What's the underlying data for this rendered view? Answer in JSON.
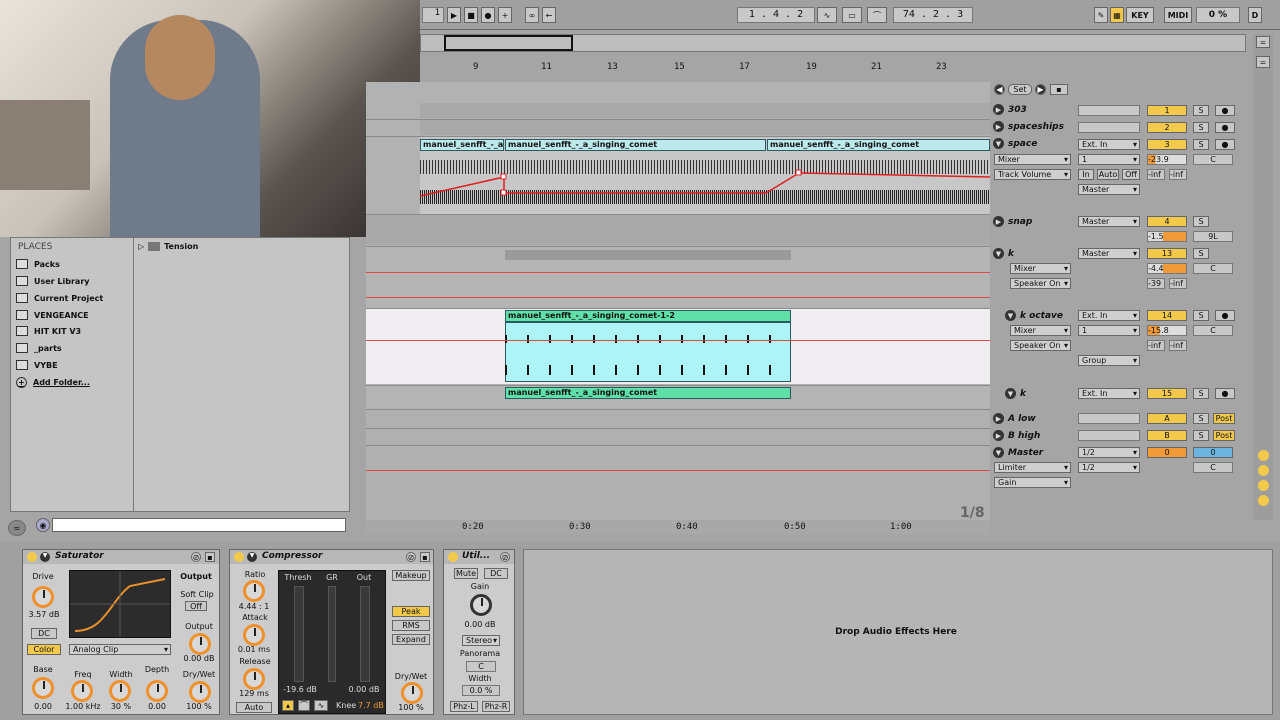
{
  "transport": {
    "bar_position": "1 . 4 . 2",
    "tempo_pos": "74 . 2 . 3",
    "loop_start": "1",
    "key_label": "KEY",
    "midi_label": "MIDI",
    "cpu": "0 %",
    "d_label": "D"
  },
  "ruler": {
    "bars": [
      "9",
      "11",
      "13",
      "15",
      "17",
      "19",
      "21",
      "23"
    ],
    "times": [
      "0:20",
      "0:30",
      "0:40",
      "0:50",
      "1:00"
    ]
  },
  "set_label": "Set",
  "clips": {
    "top1": "manuel_senfft_-_a_singing_comet",
    "top0": "manuel_senfft_-_a_singing_com",
    "top2": "manuel_senfft_-_a_singing_comet",
    "mid": "manuel_senfft_-_a_singing_comet-1-2",
    "bottom": "manuel_senfft_-_a_singing_comet"
  },
  "page_counter": "1/8",
  "tracks": [
    {
      "name": "303",
      "num": "1",
      "rec": "S"
    },
    {
      "name": "spaceships",
      "num": "2",
      "rec": "S"
    },
    {
      "name": "space",
      "num": "3",
      "input": "Ext. In",
      "channel": "1",
      "vol": "-23.9",
      "pan": "C",
      "mixer": "Mixer",
      "device": "Track Volume",
      "output": "Master",
      "monitor": [
        "In",
        "Auto",
        "Off"
      ],
      "inf1": "-inf",
      "inf2": "-inf"
    },
    {
      "name": "snap",
      "num": "4",
      "output": "Master",
      "vol": "-1.5",
      "pan": "9L"
    },
    {
      "name": "k",
      "num": "13",
      "output": "Master",
      "vol": "-4.4",
      "pan": "C",
      "mixer": "Mixer",
      "device": "Speaker On",
      "sends": "-39",
      "inf": "-inf"
    },
    {
      "name": "k octave",
      "num": "14",
      "input": "Ext. In",
      "channel": "1",
      "vol": "-15.8",
      "pan": "C",
      "mixer": "Mixer",
      "device": "Speaker On",
      "group": "Group",
      "inf1": "-inf",
      "inf2": "-inf"
    },
    {
      "name": "k",
      "num": "15",
      "input": "Ext. In"
    },
    {
      "name": "A low",
      "num": "A",
      "post": "Post"
    },
    {
      "name": "B high",
      "num": "B",
      "post": "Post"
    },
    {
      "name": "Master",
      "num": "0",
      "cue": "0",
      "io1": "1/2",
      "io2": "1/2",
      "pan": "C",
      "mixer": "Limiter",
      "device": "Gain"
    }
  ],
  "browser": {
    "places_title": "PLACES",
    "items": [
      "Packs",
      "User Library",
      "Current Project",
      "VENGEANCE",
      "HIT KIT V3",
      "_parts",
      "VYBE",
      "Add Folder..."
    ],
    "folder_item": "Tension"
  },
  "devices": {
    "saturator": {
      "title": "Saturator",
      "drive_label": "Drive",
      "drive_val": "3.57 dB",
      "dc": "DC",
      "color": "Color",
      "clip_type": "Analog Clip",
      "output_label": "Output",
      "soft_clip": "Soft Clip",
      "off": "Off",
      "output_knob_label": "Output",
      "output_val": "0.00 dB",
      "drywet_label": "Dry/Wet",
      "drywet_val": "100 %",
      "base_label": "Base",
      "base_val": "0.00",
      "freq_label": "Freq",
      "freq_val": "1.00 kHz",
      "width_label": "Width",
      "width_val": "30 %",
      "depth_label": "Depth",
      "depth_val": "0.00"
    },
    "compressor": {
      "title": "Compressor",
      "ratio_label": "Ratio",
      "ratio_val": "4.44 : 1",
      "attack_label": "Attack",
      "attack_val": "0.01 ms",
      "release_label": "Release",
      "release_val": "129 ms",
      "auto": "Auto",
      "thresh": "Thresh",
      "gr": "GR",
      "out": "Out",
      "thresh_val": "-19.6 dB",
      "out_val": "0.00 dB",
      "knee_label": "Knee",
      "knee_val": "7.7 dB",
      "makeup": "Makeup",
      "peak": "Peak",
      "rms": "RMS",
      "expand": "Expand",
      "drywet_label": "Dry/Wet",
      "drywet_val": "100 %"
    },
    "utility": {
      "title": "Util...",
      "mute": "Mute",
      "dc": "DC",
      "gain_label": "Gain",
      "gain_val": "0.00 dB",
      "stereo": "Stereo",
      "panorama_label": "Panorama",
      "pan_val": "C",
      "width_label": "Width",
      "width_val": "0.0 %",
      "phz_l": "Phz-L",
      "phz_r": "Phz-R"
    },
    "drop_hint": "Drop Audio Effects Here"
  }
}
